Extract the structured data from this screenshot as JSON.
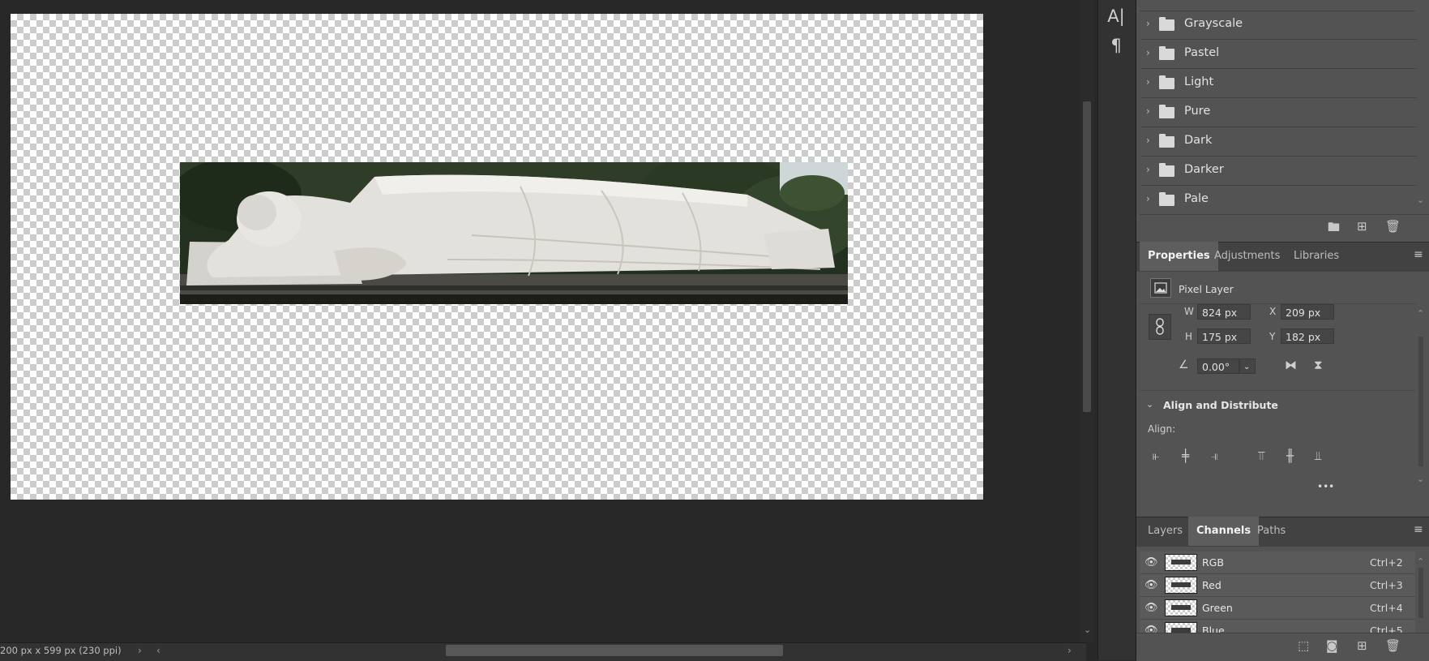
{
  "status": {
    "doc_info": "200 px x 599 px (230 ppi)",
    "expand_arrow": "›",
    "left_arrow": "‹",
    "right_arrow": "›"
  },
  "tools": {
    "char_icon": "A|",
    "para_icon": "¶"
  },
  "swatches": {
    "groups": [
      {
        "label": "Grayscale"
      },
      {
        "label": "Pastel"
      },
      {
        "label": "Light"
      },
      {
        "label": "Pure"
      },
      {
        "label": "Dark"
      },
      {
        "label": "Darker"
      },
      {
        "label": "Pale"
      }
    ]
  },
  "properties_tabs": {
    "tabs": [
      {
        "label": "Properties"
      },
      {
        "label": "Adjustments"
      },
      {
        "label": "Libraries"
      }
    ]
  },
  "properties": {
    "layer_type": "Pixel Layer",
    "w_label": "W",
    "w_value": "824 px",
    "h_label": "H",
    "h_value": "175 px",
    "x_label": "X",
    "x_value": "209 px",
    "y_label": "Y",
    "y_value": "182 px",
    "angle_value": "0.00°",
    "align_section_title": "Align and Distribute",
    "align_label": "Align:",
    "more": "•••"
  },
  "bottom_tabs": {
    "tabs": [
      {
        "label": "Layers"
      },
      {
        "label": "Channels"
      },
      {
        "label": "Paths"
      }
    ]
  },
  "channels": [
    {
      "name": "RGB",
      "shortcut": "Ctrl+2"
    },
    {
      "name": "Red",
      "shortcut": "Ctrl+3"
    },
    {
      "name": "Green",
      "shortcut": "Ctrl+4"
    },
    {
      "name": "Blue",
      "shortcut": "Ctrl+5"
    }
  ],
  "colors": {
    "app_bg": "#282828",
    "panel_bg": "#535353",
    "active_tab": "#5d5d5d"
  }
}
